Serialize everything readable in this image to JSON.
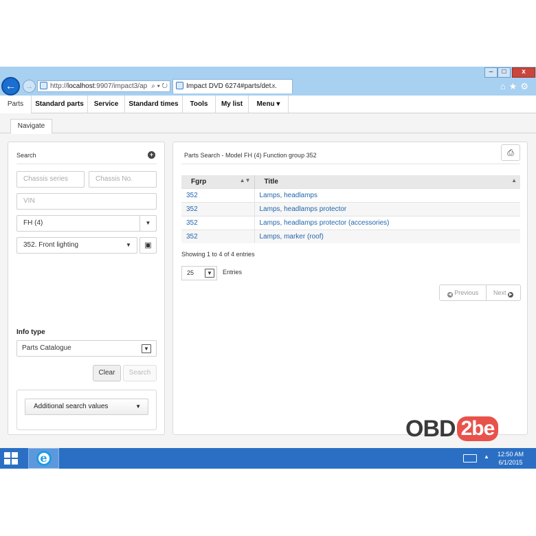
{
  "browser": {
    "address_prefix": "http://",
    "address_host": "localhost",
    "address_rest": ":9907/impact3/ap",
    "address_icons": "⌕ ▾ ↻",
    "tab_title": "Impact DVD 6274#parts/det...",
    "tab_close": "×",
    "toolbar_icons": "⌂★⚙"
  },
  "window_controls": {
    "minimize": "–",
    "maximize": "□",
    "close": "x"
  },
  "menu": {
    "items": [
      {
        "label": "Parts"
      },
      {
        "label": "Standard parts"
      },
      {
        "label": "Service"
      },
      {
        "label": "Standard times"
      },
      {
        "label": "Tools"
      },
      {
        "label": "My list"
      },
      {
        "label": "Menu ▾"
      }
    ]
  },
  "nav_tab": "Navigate",
  "search_panel": {
    "title": "Search",
    "chassis_series_placeholder": "Chassis series",
    "chassis_no_placeholder": "Chassis No.",
    "vin_placeholder": "VIN",
    "model_value": "FH (4)",
    "function_group_value": "352. Front lighting",
    "info_type_label": "Info type",
    "info_type_value": "Parts Catalogue",
    "clear_label": "Clear",
    "search_label": "Search",
    "additional_label": "Additional search values"
  },
  "results_panel": {
    "title": "Parts Search - Model FH (4) Function group 352",
    "columns": [
      "Fgrp",
      "Title"
    ],
    "rows": [
      {
        "fgrp": "352",
        "title": "Lamps, headlamps"
      },
      {
        "fgrp": "352",
        "title": "Lamps, headlamps protector"
      },
      {
        "fgrp": "352",
        "title": "Lamps, headlamps protector (accessories)"
      },
      {
        "fgrp": "352",
        "title": "Lamps, marker (roof)"
      }
    ],
    "showing_text": "Showing 1 to 4 of 4 entries",
    "page_length": "25",
    "entries_label": "Entries",
    "previous_label": "Previous",
    "next_label": "Next"
  },
  "watermark": {
    "obd": "OBD",
    "suffix": "2be"
  },
  "taskbar": {
    "time": "12:50 AM",
    "date": "6/1/2015"
  }
}
